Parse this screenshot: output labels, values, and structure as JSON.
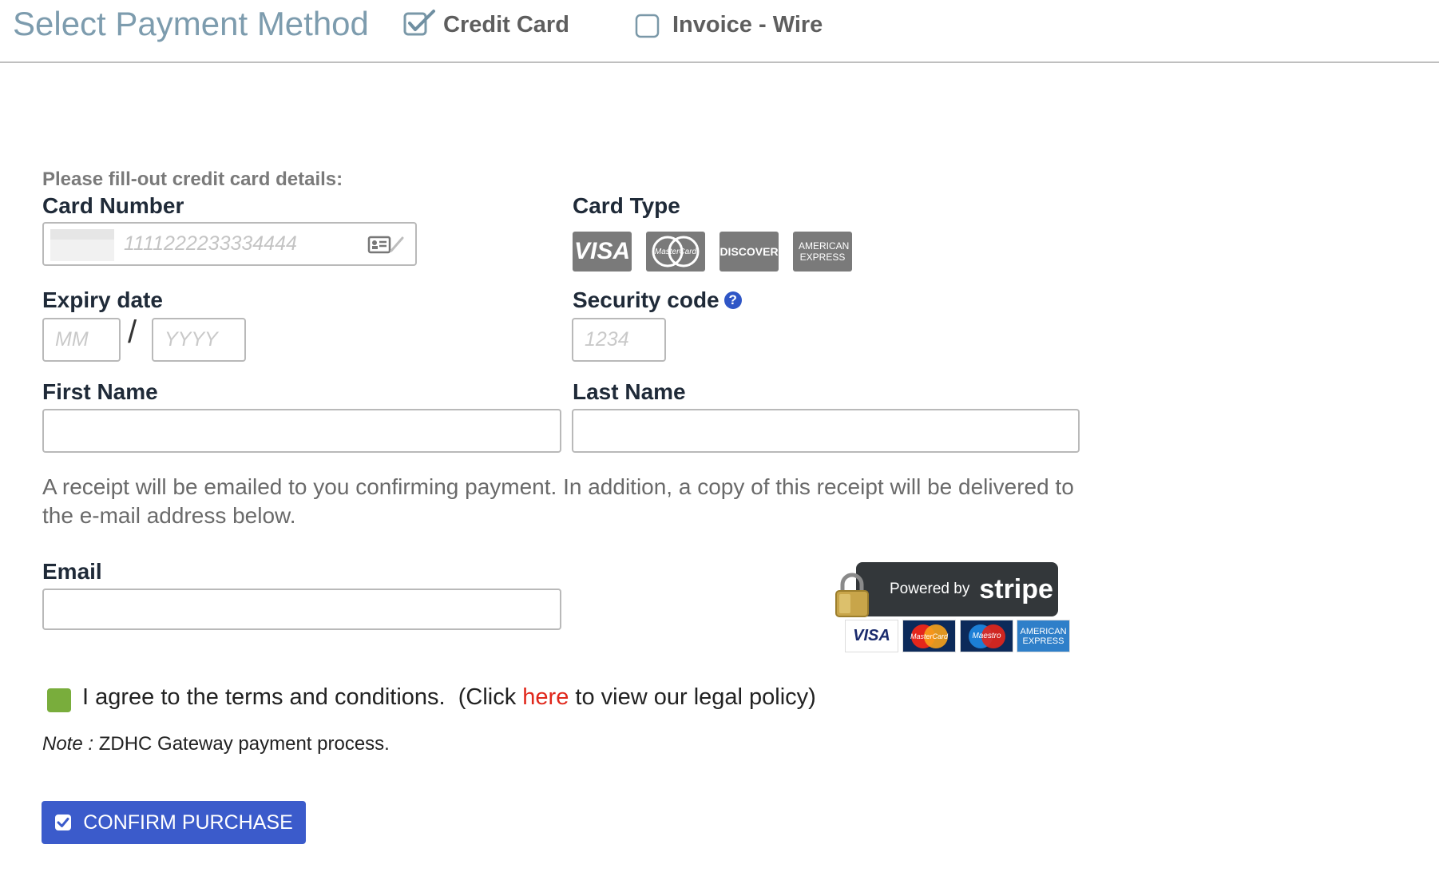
{
  "header": {
    "title": "Select Payment Method",
    "methods": [
      {
        "label": "Credit Card",
        "checked": true
      },
      {
        "label": "Invoice - Wire",
        "checked": false
      }
    ]
  },
  "form": {
    "instructions": "Please fill-out credit card details:",
    "card_number": {
      "label": "Card Number",
      "placeholder": "1111222233334444",
      "value": ""
    },
    "card_type": {
      "label": "Card Type",
      "logos": [
        {
          "name": "visa-logo",
          "text": "VISA"
        },
        {
          "name": "mastercard-logo",
          "text": "MasterCard"
        },
        {
          "name": "discover-logo",
          "text": "DISCOVER"
        },
        {
          "name": "american-express-logo",
          "text": "AMERICAN EXPRESS"
        }
      ]
    },
    "expiry": {
      "label": "Expiry date",
      "month_placeholder": "MM",
      "separator": "/",
      "year_placeholder": "YYYY"
    },
    "security_code": {
      "label": "Security code",
      "help": "?",
      "placeholder": "1234"
    },
    "first_name": {
      "label": "First Name",
      "value": ""
    },
    "last_name": {
      "label": "Last Name",
      "value": ""
    },
    "receipt_note": "A receipt will be emailed to you confirming payment. In addition, a copy of this receipt will be delivered to the e-mail address below.",
    "email": {
      "label": "Email",
      "value": ""
    }
  },
  "stripe": {
    "powered_by": "Powered by",
    "brand": "stripe",
    "accepted": [
      "VISA",
      "MasterCard",
      "Maestro",
      "AMERICAN EXPRESS"
    ]
  },
  "agreement": {
    "text_before": "I agree to the terms and conditions.",
    "click_prefix": "(Click",
    "link_text": "here",
    "click_suffix": "to view our legal policy)"
  },
  "note": {
    "label": "Note :",
    "text": "ZDHC Gateway payment process."
  },
  "confirm": {
    "label": "CONFIRM PURCHASE"
  },
  "colors": {
    "title": "#7d9cae",
    "primary_button": "#3b5bcb",
    "agree_checkbox": "#79ad3c",
    "link": "#e0271b",
    "card_logo_gray": "#7a7a7a"
  }
}
